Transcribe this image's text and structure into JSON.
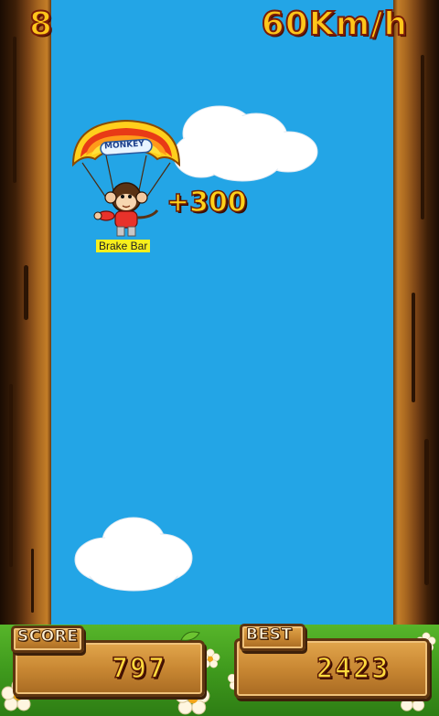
{
  "hud": {
    "lives": "8",
    "speed": "60Km/h"
  },
  "player": {
    "parachute_text": "MONKEY",
    "bonus": "+300",
    "powerup_label": "Brake Bar"
  },
  "scoreboard": {
    "score_label": "SCORE",
    "score_value": "797",
    "best_label": "BEST",
    "best_value": "2423"
  },
  "colors": {
    "sky": "#23a5e6",
    "hud_text": "#ffc61a",
    "grass": "#4aa824",
    "wood": "#c98833"
  }
}
